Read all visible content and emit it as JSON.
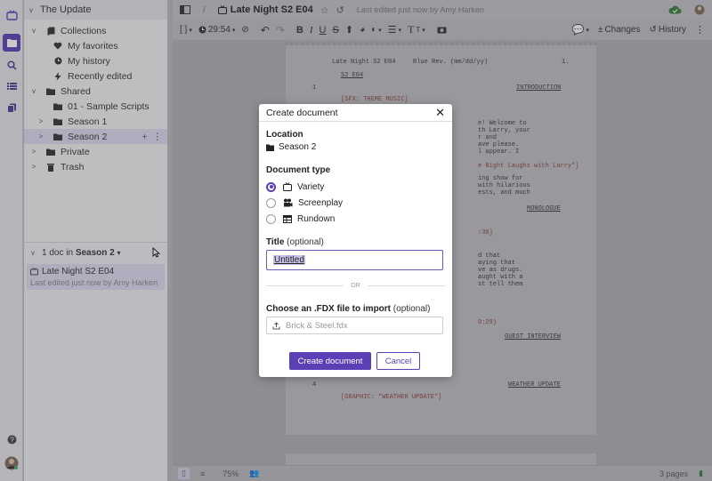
{
  "sidebar": {
    "workspace": "The Update",
    "tree": [
      {
        "label": "Collections",
        "icon": "collections-icon",
        "chev": "v",
        "indent": 1
      },
      {
        "label": "My favorites",
        "icon": "heart-icon",
        "chev": "",
        "indent": 2
      },
      {
        "label": "My history",
        "icon": "clock-icon",
        "chev": "",
        "indent": 2
      },
      {
        "label": "Recently edited",
        "icon": "bolt-icon",
        "chev": "",
        "indent": 2
      },
      {
        "label": "Shared",
        "icon": "folder-icon",
        "chev": "v",
        "indent": 1
      },
      {
        "label": "01 - Sample Scripts",
        "icon": "folder-icon",
        "chev": "",
        "indent": 2
      },
      {
        "label": "Season 1",
        "icon": "folder-icon",
        "chev": ">",
        "indent": 2
      },
      {
        "label": "Season 2",
        "icon": "folder-icon",
        "chev": ">",
        "indent": 2
      },
      {
        "label": "Private",
        "icon": "folder-icon",
        "chev": ">",
        "indent": 1
      },
      {
        "label": "Trash",
        "icon": "trash-icon",
        "chev": ">",
        "indent": 1
      }
    ],
    "doc_pane": {
      "count_text": "1 doc in",
      "folder": "Season 2",
      "doc_title": "Late Night S2 E04",
      "doc_subtitle": "Last edited just now by Amy Harken"
    }
  },
  "topbar": {
    "separator": "/",
    "title": "Late Night S2 E04",
    "edited": "Last edited just now by Amy Harken"
  },
  "toolbar": {
    "timer": "29:54",
    "changes": "Changes",
    "history": "History"
  },
  "script": {
    "header_left": "Late Night S2 E04",
    "header_mid": "Blue Rev. (mm/dd/yy)",
    "page_num": "1.",
    "scene_code": "S2 E04",
    "line_num": "1",
    "intro": "INTRODUCTION",
    "sfx": "[SFX: THEME MUSIC]",
    "frag1": "e! Welcome to",
    "frag2": "th Larry, your",
    "frag3": "r and",
    "frag4": "ave please.",
    "frag5": "l appear. I",
    "frag6": "e Night Laughs with Larry\"]",
    "frag7": "ing show for",
    "frag8": "with hilarious",
    "frag9": "ests, and much",
    "monologue": "MONOLOGUE",
    "frag10": ":30]",
    "frag11": "d that",
    "frag12": "aying that",
    "frag13": "ve as drugs.",
    "frag14": "aught with a",
    "frag15": "st tell them",
    "frag16": "0:29)",
    "guest": "GUEST INTERVIEW",
    "line_num2": "4",
    "weather": "WEATHER UPDATE",
    "graphic": "[GRAPHIC: \"WEATHER UPDATE\"]"
  },
  "statusbar": {
    "zoom": "75%",
    "pages": "3 pages"
  },
  "modal": {
    "title": "Create document",
    "location_label": "Location",
    "location_value": "Season 2",
    "doc_type_label": "Document type",
    "doc_types": [
      {
        "label": "Variety",
        "icon": "tv-icon",
        "selected": true
      },
      {
        "label": "Screenplay",
        "icon": "camera-icon",
        "selected": false
      },
      {
        "label": "Rundown",
        "icon": "table-icon",
        "selected": false
      }
    ],
    "title_label": "Title",
    "title_optional": "(optional)",
    "title_value": "Untitled",
    "or_text": "OR",
    "import_label": "Choose an .FDX file to import",
    "import_optional": "(optional)",
    "import_placeholder": "Brick & Steel.fdx",
    "create_button": "Create document",
    "cancel_button": "Cancel"
  },
  "colors": {
    "accent": "#5b3fb5",
    "selection": "#ddd8ef"
  }
}
